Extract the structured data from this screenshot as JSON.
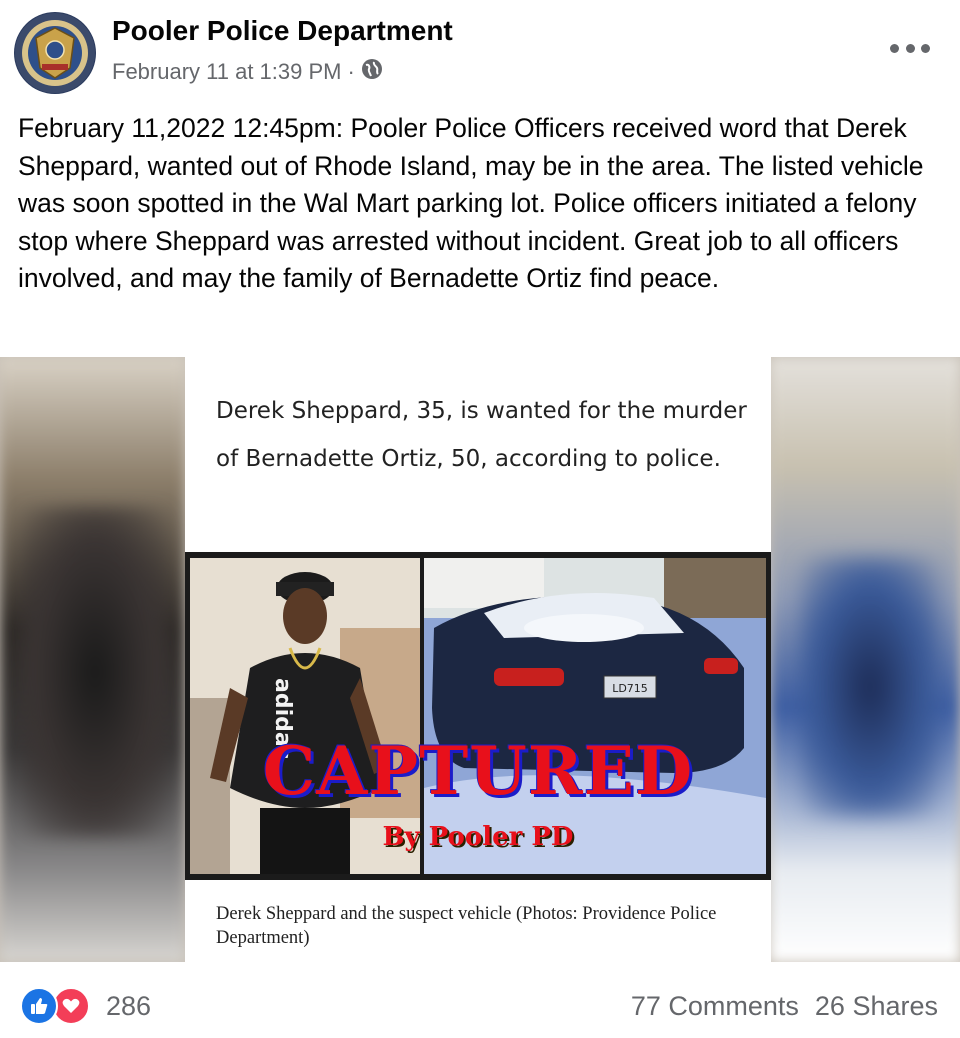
{
  "post": {
    "page_name": "Pooler Police Department",
    "timestamp": "February 11 at 1:39 PM",
    "separator": "·",
    "audience_icon": "globe-icon",
    "more_icon": "more-dots-icon",
    "avatar": {
      "icon": "police-badge-logo",
      "logo_text": [
        "POOLER, GEORGIA",
        "POOLER",
        "POLICE",
        "FAMILY",
        "HONOR"
      ]
    },
    "text": "February 11,2022 12:45pm: Pooler Police Officers received word that Derek Sheppard, wanted out of Rhode Island, may be in the area. The listed vehicle was soon spotted in the Wal Mart parking lot. Police officers initiated a felony stop where Sheppard was arrested without incident. Great job to all officers involved, and may the family of Bernadette Ortiz find peace."
  },
  "media": {
    "headline": "Derek Sheppard, 35, is wanted for the murder of Bernadette Ortiz, 50, according to police.",
    "overlay_title": "CAPTURED",
    "overlay_subtitle": "By Pooler PD",
    "shirt_text": "adidas",
    "plate_text": "LD715",
    "caption": "Derek Sheppard and the suspect vehicle (Photos: Providence Police Department)"
  },
  "footer": {
    "reaction_icons": [
      "like-icon",
      "love-icon"
    ],
    "reaction_count": "286",
    "comments": "77 Comments",
    "shares": "26 Shares"
  },
  "colors": {
    "text": "#050505",
    "secondary": "#65676b",
    "like": "#1b74e4",
    "love": "#f33e58",
    "captured_red": "#e8101b",
    "captured_shadow": "#1b1cc9"
  }
}
